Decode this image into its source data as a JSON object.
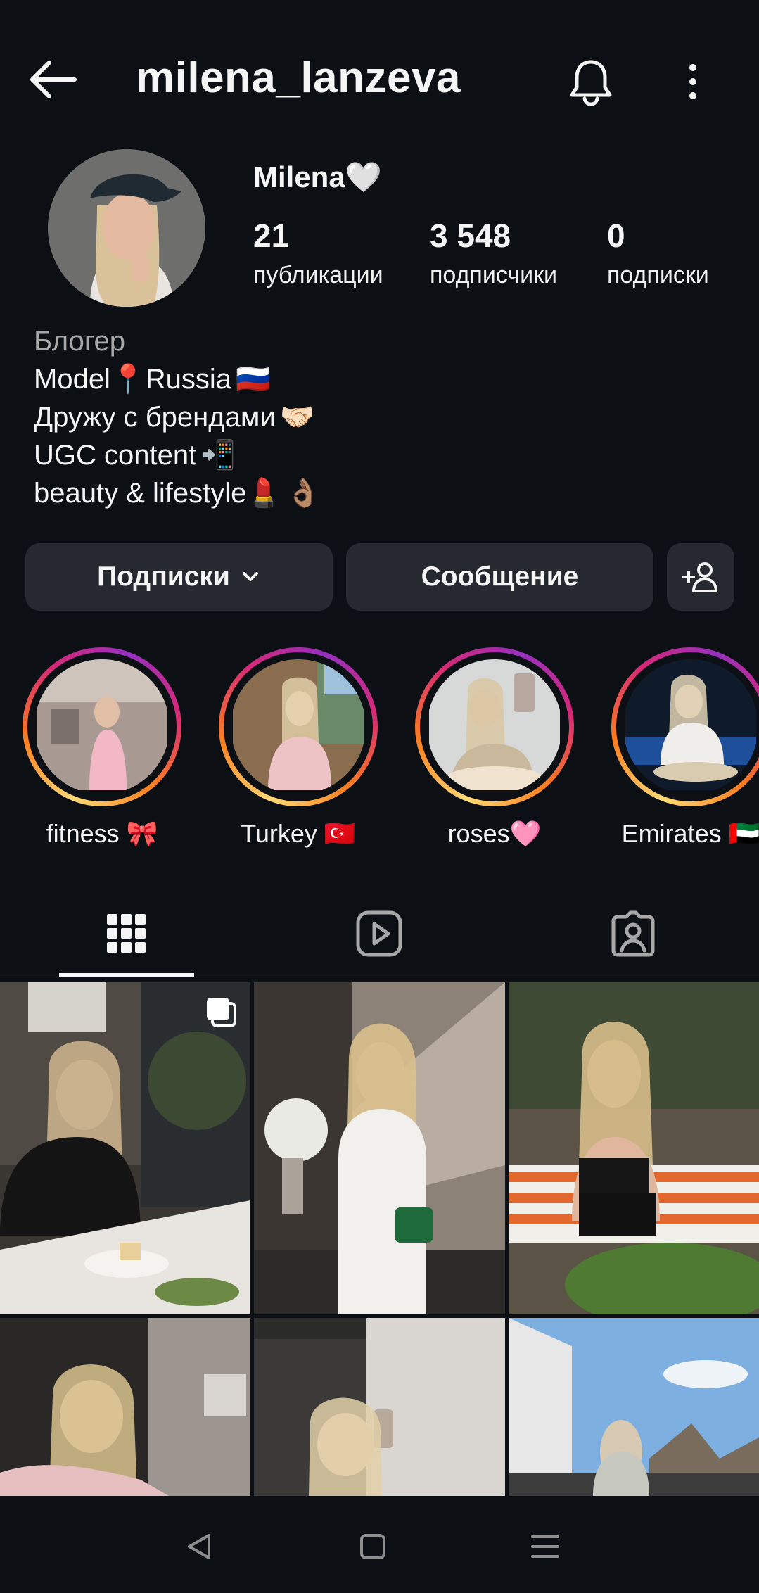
{
  "header": {
    "username": "milena_lanzeva"
  },
  "profile": {
    "display_name": "Milena🤍",
    "stats": [
      {
        "value": "21",
        "label": "публикации"
      },
      {
        "value": "3 548",
        "label": "подписчики"
      },
      {
        "value": "0",
        "label": "подписки"
      }
    ],
    "category": "Блогер",
    "bio_lines": [
      {
        "text": "Model📍Russia",
        "emoji": "🇷🇺"
      },
      {
        "text": "Дружу с брендами",
        "emoji": "🤝🏻"
      },
      {
        "text": "UGC content",
        "emoji": "📲"
      },
      {
        "text": "beauty & lifestyle💄",
        "emoji": "👌🏽"
      }
    ]
  },
  "actions": {
    "following_label": "Подписки",
    "message_label": "Сообщение"
  },
  "highlights": [
    {
      "label": "fitness 🎀"
    },
    {
      "label": "Turkey 🇹🇷"
    },
    {
      "label": "roses🩷"
    },
    {
      "label": "Emirates 🇦🇪"
    }
  ],
  "tabs": [
    "posts-grid",
    "reels",
    "tagged"
  ],
  "colors": {
    "background": "#0c1014",
    "button_bg": "#262a30",
    "text": "#f5f5f5",
    "muted": "#a8a8a8"
  }
}
